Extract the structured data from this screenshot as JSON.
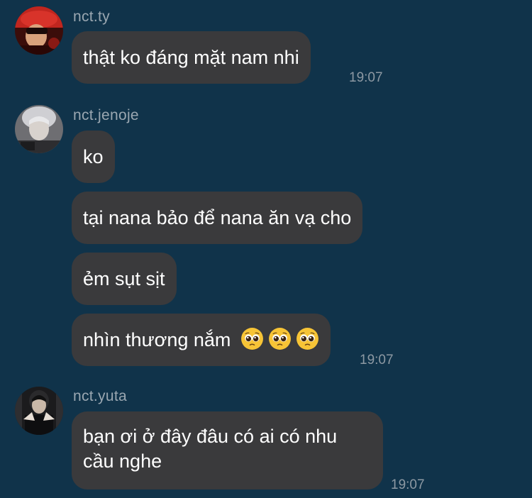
{
  "messages": [
    {
      "username": "nct.ty",
      "avatar_icon": "avatar-red-icon",
      "bubbles": [
        "thật ko đáng mặt nam nhi"
      ],
      "time": "19:07"
    },
    {
      "username": "nct.jenoje",
      "avatar_icon": "avatar-gray-icon",
      "bubbles": [
        "ko",
        "tại nana bảo để nana ăn vạ cho",
        "ẻm sụt sịt",
        "nhìn thương nắm"
      ],
      "emoji": [
        "pleading-face-icon",
        "pleading-face-icon",
        "pleading-face-icon"
      ],
      "time": "19:07"
    },
    {
      "username": "nct.yuta",
      "avatar_icon": "avatar-dark-icon",
      "bubbles": [
        "bạn ơi ở đây đâu có ai có nhu cầu nghe"
      ],
      "time": "19:07"
    }
  ],
  "colors": {
    "background": "#10334a",
    "bubble": "#3a3a3c",
    "username": "#9aa7b1",
    "timestamp": "#8d99a3"
  }
}
